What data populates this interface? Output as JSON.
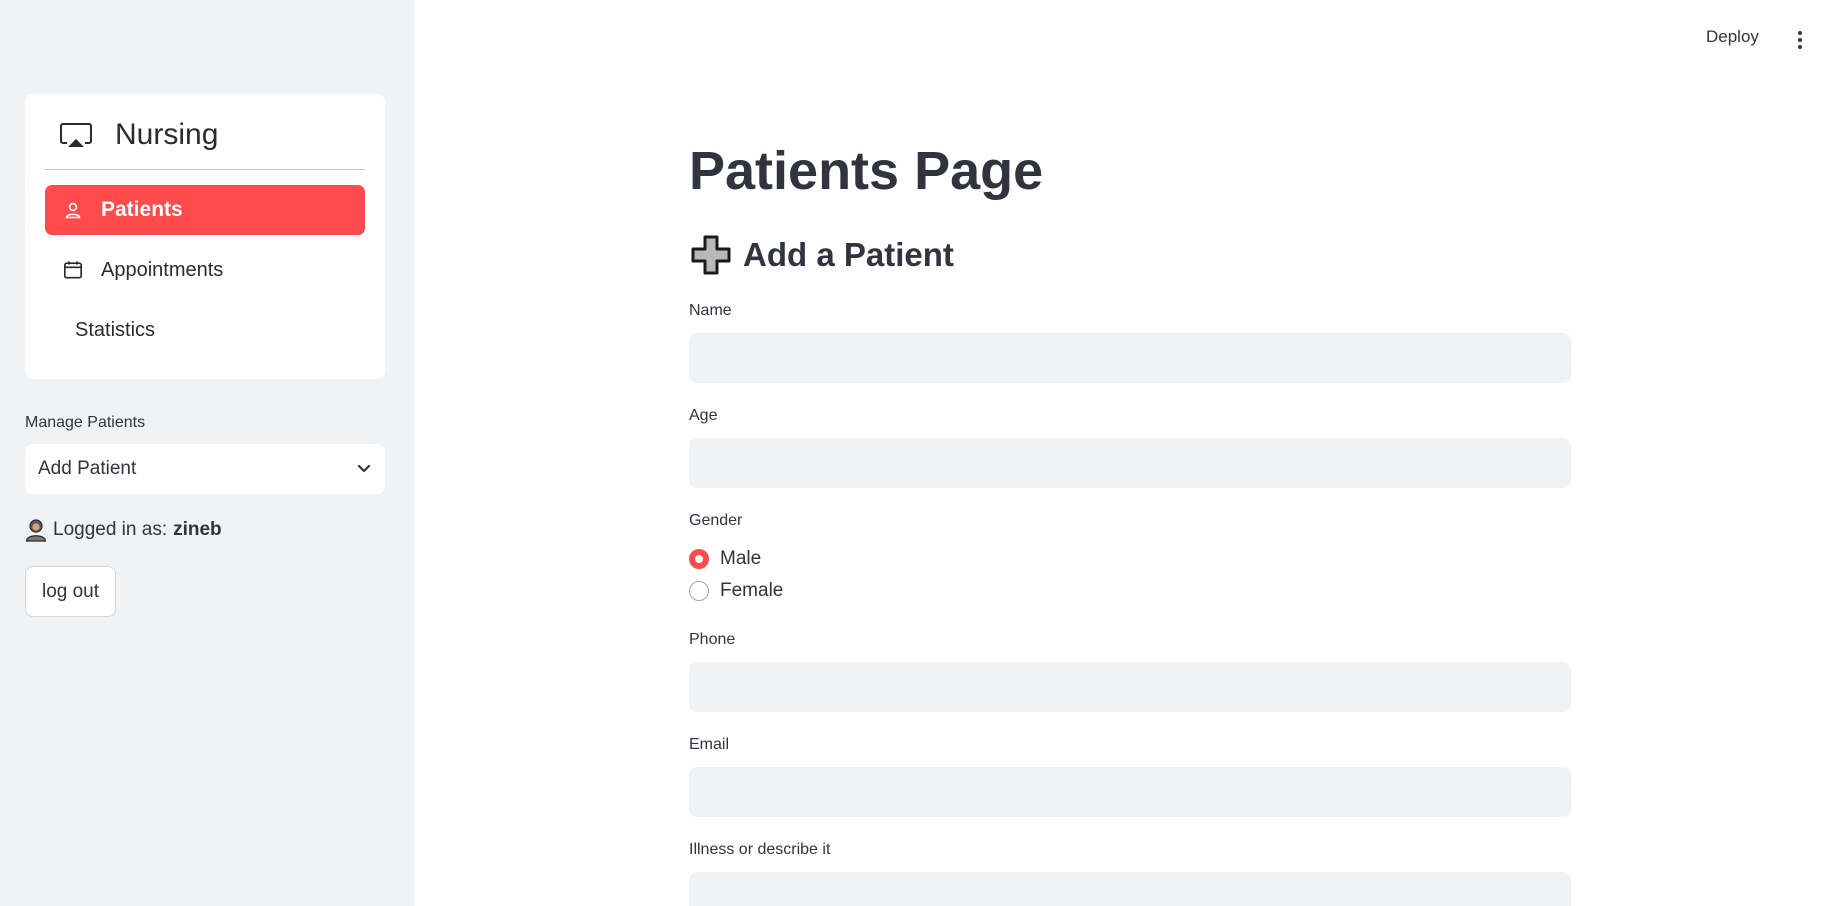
{
  "sidebar": {
    "nav_title": "Nursing",
    "items": [
      {
        "label": "Patients",
        "icon": "person-icon",
        "active": true
      },
      {
        "label": "Appointments",
        "icon": "calendar-icon",
        "active": false
      },
      {
        "label": "Statistics",
        "icon": "",
        "active": false
      }
    ],
    "manage_label": "Manage Patients",
    "manage_selected": "Add Patient",
    "logged_in_prefix": "Logged in as:",
    "logged_in_user": "zineb",
    "logout_label": "log out"
  },
  "topbar": {
    "deploy_label": "Deploy"
  },
  "main": {
    "page_title": "Patients Page",
    "section_title": "Add a Patient",
    "fields": {
      "name_label": "Name",
      "name_value": "",
      "age_label": "Age",
      "age_value": "",
      "gender_label": "Gender",
      "gender_options": [
        "Male",
        "Female"
      ],
      "gender_selected": "Male",
      "phone_label": "Phone",
      "phone_value": "",
      "email_label": "Email",
      "email_value": "",
      "illness_label": "Illness or describe it",
      "illness_value": ""
    }
  },
  "colors": {
    "accent": "#ff4b4b",
    "sidebar_bg": "#f0f2f6",
    "input_bg": "#f0f2f6",
    "text": "#31333f"
  }
}
